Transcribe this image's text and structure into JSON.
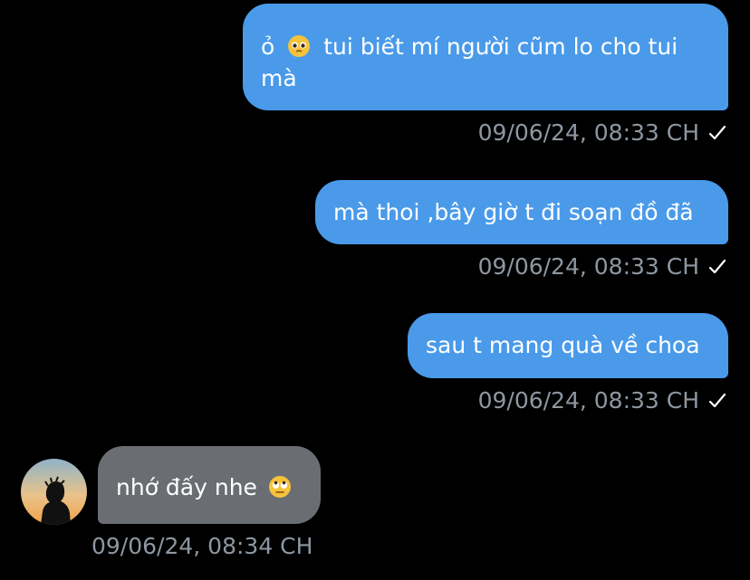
{
  "messages": [
    {
      "direction": "outgoing",
      "text_before_emoji": "ỏ",
      "emoji": "pleading-face-emoji",
      "text_after_emoji": "tui biết mí người cũm lo cho tui mà",
      "time": "09/06/24, 08:33 CH",
      "status": "sent-check-icon"
    },
    {
      "direction": "outgoing",
      "text": "mà thoi ,bây giờ t đi soạn đồ đã",
      "time": "09/06/24, 08:33 CH",
      "status": "sent-check-icon"
    },
    {
      "direction": "outgoing",
      "text": "sau t mang quà về choa",
      "time": "09/06/24, 08:33 CH",
      "status": "sent-check-icon"
    },
    {
      "direction": "incoming",
      "text": "nhớ đấy nhe",
      "emoji": "eye-roll-emoji",
      "time": "09/06/24, 08:34 CH",
      "avatar": "avatar"
    }
  ],
  "colors": {
    "background": "#000000",
    "outgoing_bubble": "#4a9ae9",
    "incoming_bubble": "#6a6d72",
    "timestamp": "#8e97a1"
  }
}
